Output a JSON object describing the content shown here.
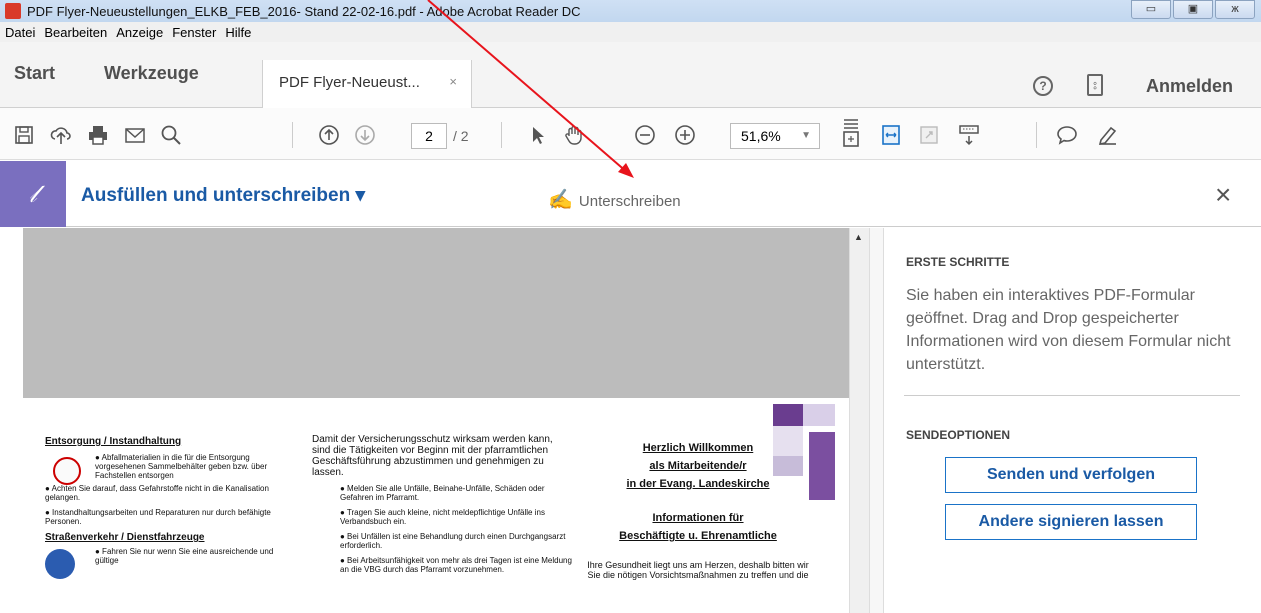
{
  "window": {
    "title": "PDF Flyer-Neueustellungen_ELKB_FEB_2016- Stand 22-02-16.pdf - Adobe Acrobat Reader DC",
    "controls": [
      "▭",
      "▣",
      "ж"
    ]
  },
  "menu": [
    "Datei",
    "Bearbeiten",
    "Anzeige",
    "Fenster",
    "Hilfe"
  ],
  "tabs": {
    "start": "Start",
    "tools": "Werkzeuge",
    "doc": "PDF Flyer-Neueust...",
    "doc_close": "×",
    "help": "?",
    "mobile": "⦂",
    "signin": "Anmelden"
  },
  "toolbar": {
    "page_current": "2",
    "page_total": "/ 2",
    "zoom": "51,6%",
    "zoom_caret": "▼"
  },
  "fill": {
    "title": "Ausfüllen und unterschreiben ▾",
    "sign": "Unterschreiben",
    "close": "×",
    "icon": "𝓁"
  },
  "doc": {
    "col1": {
      "h1": "Entsorgung / Instandhaltung",
      "b1": "● Abfallmaterialien in die für die Entsorgung vorgesehenen Sammelbehälter geben bzw. über Fachstellen entsorgen",
      "b2": "● Achten Sie darauf, dass Gefahrstoffe nicht in die Kanalisation gelangen.",
      "b3": "● Instandhaltungsarbeiten und Reparaturen nur durch befähigte Personen.",
      "h2": "Straßenverkehr / Dienstfahrzeuge",
      "b4": "● Fahren Sie nur wenn Sie eine ausreichende und gültige"
    },
    "col2": {
      "p": "Damit der Versicherungsschutz wirksam werden kann, sind die Tätigkeiten vor Beginn mit der pfarramtlichen Geschäftsführung abzustimmen und genehmigen zu lassen.",
      "b1": "● Melden Sie alle Unfälle, Beinahe-Unfälle, Schäden oder Gefahren im Pfarramt.",
      "b2": "● Tragen Sie auch kleine, nicht meldepflichtige Unfälle ins Verbandsbuch ein.",
      "b3": "● Bei Unfällen ist eine Behandlung durch einen Durchgangsarzt erforderlich.",
      "b4": "● Bei Arbeitsunfähigkeit von mehr als drei Tagen ist eine Meldung an die VBG durch das Pfarramt vorzunehmen."
    },
    "col3": {
      "l1": "Herzlich Willkommen",
      "l2": "als Mitarbeitende/r",
      "l3": "in der Evang. Landeskirche",
      "l4": "Informationen für",
      "l5": "Beschäftigte u. Ehrenamtliche",
      "p": "Ihre Gesundheit liegt uns am Herzen, deshalb bitten wir Sie die nötigen Vorsichtsmaßnahmen zu treffen und die"
    }
  },
  "panel": {
    "h1": "ERSTE SCHRITTE",
    "text": "Sie haben ein interaktives PDF-Formular geöffnet. Drag and Drop gespeicherter Informationen wird von diesem Formular nicht unterstützt.",
    "h2": "SENDEOPTIONEN",
    "btn1": "Senden und verfolgen",
    "btn2": "Andere signieren lassen"
  },
  "colors": {
    "accent": "#1a5aa5",
    "arrow": "#e8141c",
    "fill_icon": "#7a6fbf"
  }
}
